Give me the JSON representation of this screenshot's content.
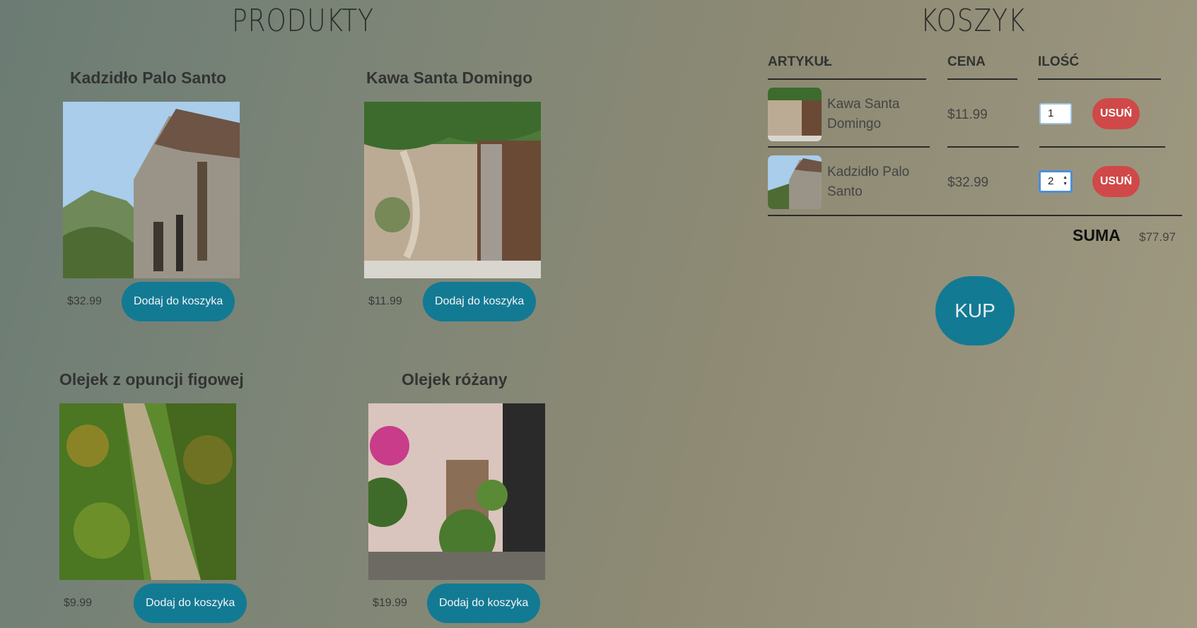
{
  "products_section": {
    "title": "PRODUKTY",
    "add_label": "Dodaj do koszyka",
    "items": [
      {
        "name": "Kadzidło Palo Santo",
        "price": "$32.99",
        "image": "stone-house-photo"
      },
      {
        "name": "Kawa Santa Domingo",
        "price": "$11.99",
        "image": "stone-doorway-photo"
      },
      {
        "name": "Olejek z opuncji figowej",
        "price": "$9.99",
        "image": "vineyard-path-photo"
      },
      {
        "name": "Olejek różany",
        "price": "$19.99",
        "image": "flower-alley-photo"
      }
    ]
  },
  "cart": {
    "title": "KOSZYK",
    "headers": {
      "item": "ARTYKUŁ",
      "price": "CENA",
      "qty": "ILOŚĆ"
    },
    "remove_label": "USUŃ",
    "rows": [
      {
        "name": "Kawa Santa Domingo",
        "price": "$11.99",
        "qty": "1"
      },
      {
        "name": "Kadzidło Palo Santo",
        "price": "$32.99",
        "qty": "2"
      }
    ],
    "total_label": "SUMA",
    "total_value": "$77.97",
    "buy_label": "KUP"
  },
  "colors": {
    "accent": "#137a94",
    "danger": "#d04848"
  }
}
